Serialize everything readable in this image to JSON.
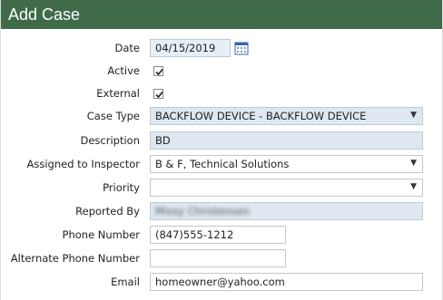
{
  "window": {
    "title": "Add Case"
  },
  "form": {
    "date": {
      "label": "Date",
      "value": "04/15/2019"
    },
    "active": {
      "label": "Active",
      "checked": true
    },
    "external": {
      "label": "External",
      "checked": true
    },
    "case_type": {
      "label": "Case Type",
      "value": "BACKFLOW DEVICE - BACKFLOW DEVICE"
    },
    "description": {
      "label": "Description",
      "value": "BD"
    },
    "assigned_to_inspector": {
      "label": "Assigned to Inspector",
      "value": "B & F, Technical Solutions"
    },
    "priority": {
      "label": "Priority",
      "value": ""
    },
    "reported_by": {
      "label": "Reported By",
      "value": "Missy Christensen"
    },
    "phone_number": {
      "label": "Phone Number",
      "value": "(847)555-1212"
    },
    "alternate_phone_number": {
      "label": "Alternate Phone Number",
      "value": ""
    },
    "email": {
      "label": "Email",
      "value": "homeowner@yahoo.com"
    }
  },
  "icons": {
    "calendar": "calendar-icon",
    "dropdown": "chevron-down-icon",
    "checkmark": "checkmark-icon"
  },
  "colors": {
    "header_bg": "#3f6b49",
    "readonly_bg": "#dfe8f1"
  }
}
